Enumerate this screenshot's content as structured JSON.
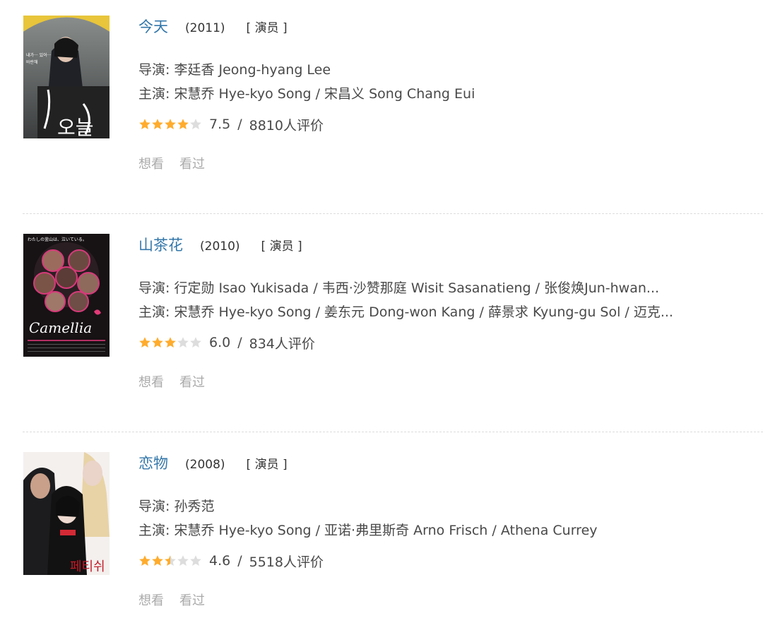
{
  "films": [
    {
      "title": "今天",
      "year": "(2011)",
      "role": "[ 演员 ]",
      "director_line": "导演: 李廷香 Jeong-hyang Lee",
      "cast_line": "主演: 宋慧乔 Hye-kyo Song / 宋昌义 Song Chang Eui",
      "rating_stars": 4,
      "score": "7.5",
      "separator": "/",
      "votes": "8810人评价",
      "poster_text": [
        "내가··· 있어···",
        "바란해",
        "오늘"
      ],
      "actions": [
        "想看",
        "看过"
      ]
    },
    {
      "title": "山茶花",
      "year": "(2010)",
      "role": "[ 演员 ]",
      "director_line": "导演: 行定勋 Isao Yukisada / 韦西·沙赞那庭 Wisit Sasanatieng / 张俊焕Jun-hwan...",
      "cast_line": "主演: 宋慧乔 Hye-kyo Song / 姜东元 Dong-won Kang / 薛景求 Kyung-gu Sol / 迈克...",
      "rating_stars": 3,
      "score": "6.0",
      "separator": "/",
      "votes": "834人评价",
      "poster_text": [
        "わたしの釜山は、泣いている。",
        "Camellia"
      ],
      "actions": [
        "想看",
        "看过"
      ]
    },
    {
      "title": "恋物",
      "year": "(2008)",
      "role": "[ 演员 ]",
      "director_line": "导演: 孙秀范",
      "cast_line": "主演: 宋慧乔 Hye-kyo Song / 亚诺·弗里斯奇 Arno Frisch / Athena Currey",
      "rating_stars": 2.5,
      "score": "4.6",
      "separator": "/",
      "votes": "5518人评价",
      "poster_text": [
        "페티쉬"
      ],
      "actions": [
        "想看",
        "看过"
      ]
    }
  ],
  "colors": {
    "title": "#3377aa",
    "text": "#494949",
    "muted": "#aaaaaa",
    "star_on": "#ffac2d",
    "star_off": "#dddddd"
  }
}
